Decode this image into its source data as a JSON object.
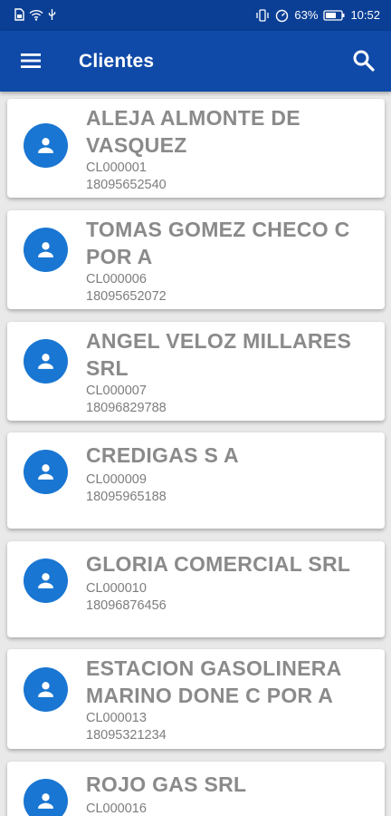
{
  "status_bar": {
    "battery": "63%",
    "time": "10:52"
  },
  "app_bar": {
    "title": "Clientes",
    "menu_icon": "menu-icon",
    "search_icon": "search-icon"
  },
  "colors": {
    "status_bar": "#0b3f95",
    "app_bar": "#0f4aa8",
    "avatar": "#1976d2",
    "text_primary": "#8a8a8a",
    "background": "#e9e9e9"
  },
  "clients": [
    {
      "name": "ALEJA ALMONTE DE VASQUEZ",
      "code": "CL000001",
      "phone": "18095652540"
    },
    {
      "name": "TOMAS GOMEZ CHECO C POR A",
      "code": "CL000006",
      "phone": "18095652072"
    },
    {
      "name": "ANGEL VELOZ MILLARES SRL",
      "code": "CL000007",
      "phone": "18096829788"
    },
    {
      "name": "CREDIGAS S A",
      "code": "CL000009",
      "phone": "18095965188"
    },
    {
      "name": "GLORIA COMERCIAL SRL",
      "code": "CL000010",
      "phone": "18096876456"
    },
    {
      "name": "ESTACION GASOLINERA MARINO DONE C POR A",
      "code": "CL000013",
      "phone": "18095321234"
    },
    {
      "name": "ROJO GAS SRL",
      "code": "CL000016",
      "phone": ""
    }
  ]
}
